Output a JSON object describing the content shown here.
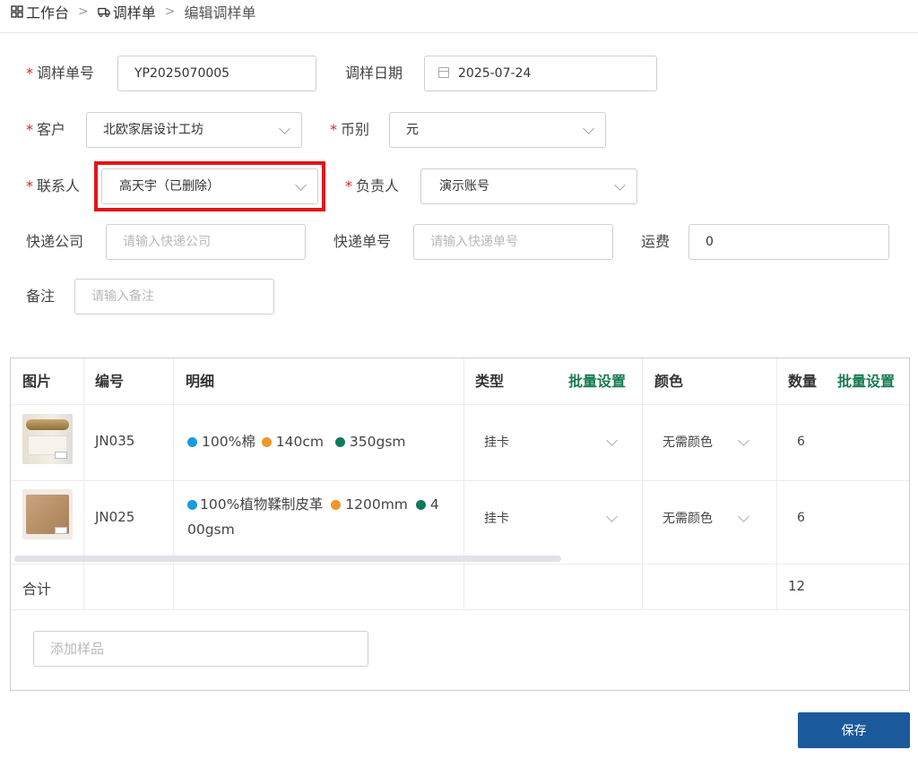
{
  "breadcrumb": [
    {
      "label": "工作台",
      "icon": "grid-icon"
    },
    {
      "label": "调样单",
      "icon": "truck-icon"
    },
    {
      "label": "编辑调样单"
    }
  ],
  "form": {
    "order_no_label": "调样单号",
    "order_no_value": "YP2025070005",
    "date_label": "调样日期",
    "date_value": "2025-07-24",
    "customer_label": "客户",
    "customer_value": "北欧家居设计工坊",
    "currency_label": "币别",
    "currency_value": "元",
    "contact_label": "联系人",
    "contact_value": "高天宇（已删除）",
    "owner_label": "负责人",
    "owner_value": "演示账号",
    "courier_label": "快递公司",
    "courier_placeholder": "请输入快递公司",
    "tracking_label": "快递单号",
    "tracking_placeholder": "请输入快递单号",
    "freight_label": "运费",
    "freight_value": "0",
    "remark_label": "备注",
    "remark_placeholder": "请输入备注",
    "required_mark": "*"
  },
  "table": {
    "headers": {
      "image": "图片",
      "code": "编号",
      "detail": "明细",
      "type": "类型",
      "type_bulk": "批量设置",
      "color": "颜色",
      "qty": "数量",
      "qty_bulk": "批量设置"
    },
    "rows": [
      {
        "code": "JN035",
        "detail": [
          {
            "text": "100%棉",
            "dot": "#1a9be0"
          },
          {
            "text": "140cm",
            "dot": "#f0962a"
          },
          {
            "text": "350gsm",
            "dot": "#0f7a5a"
          }
        ],
        "type": "挂卡",
        "color": "无需颜色",
        "qty": "6"
      },
      {
        "code": "JN025",
        "detail": [
          {
            "text": "100%植物鞣制皮革",
            "dot": "#1a9be0"
          },
          {
            "text": "1200mm",
            "dot": "#f0962a"
          },
          {
            "text": "4",
            "dot": "#0f7a5a"
          }
        ],
        "detail_wrap": "00gsm",
        "type": "挂卡",
        "color": "无需颜色",
        "qty": "6"
      }
    ],
    "total_label": "合计",
    "total_qty": "12",
    "add_placeholder": "添加样品"
  },
  "save_label": "保存",
  "colors": {
    "accent": "#1a5a9c",
    "bulk": "#177a4f",
    "required": "#e02020",
    "highlight": "#e3141a"
  }
}
